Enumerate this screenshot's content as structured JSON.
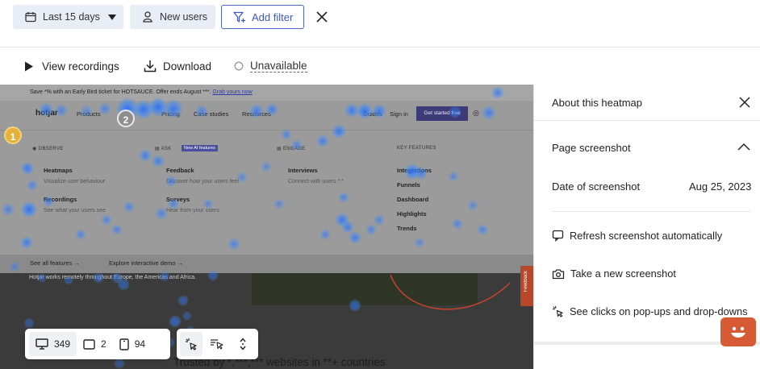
{
  "filters": {
    "date_range": "Last 15 days",
    "segment": "New users",
    "add_filter": "Add filter"
  },
  "actions": {
    "view_recordings": "View recordings",
    "download": "Download",
    "unavailable": "Unavailable"
  },
  "site": {
    "banner": "Save *% with an Early Bird ticket for HOTSAUCE. Offer ends August ***.",
    "banner_link": "Grab yours now",
    "logo": "hotjar",
    "nav": [
      "Products",
      "Pricing",
      "Case studies",
      "Resources",
      "Guides",
      "Sign in"
    ],
    "cta": "Get started free",
    "sections": {
      "observe": "OBSERVE",
      "ask": "ASK",
      "new_ai": "New AI features",
      "engage": "ENGAGE",
      "key_features": "KEY FEATURES"
    },
    "items": {
      "heatmaps": "Heatmaps",
      "heatmaps_desc": "Visualize user behaviour",
      "recordings": "Recordings",
      "recordings_desc": "See what your users see",
      "feedback": "Feedback",
      "feedback_desc": "Discover how your users feel",
      "surveys": "Surveys",
      "surveys_desc": "Hear from your users",
      "interviews": "Interviews",
      "interviews_desc": "Connect with users *:*",
      "key": [
        "Integrations",
        "Funnels",
        "Dashboard",
        "Highlights",
        "Trends"
      ]
    },
    "see_all": "See all features →",
    "explore": "Explore interactive demo →",
    "hotjar_text": "Hotjar works remotely throughout Europe, the Americas and Africa.",
    "trusted": "Trusted by *,***,*** websites in **+ countries",
    "feedback_tab": "Feedback"
  },
  "markers": [
    "1",
    "2"
  ],
  "toolbar": {
    "desktop_count": "349",
    "tablet_count": "2",
    "mobile_count": "94"
  },
  "panel": {
    "title": "About this heatmap",
    "section": "Page screenshot",
    "date_label": "Date of screenshot",
    "date_value": "Aug 25, 2023",
    "refresh": "Refresh screenshot automatically",
    "take_new": "Take a new screenshot",
    "see_clicks": "See clicks on pop-ups and drop-downs"
  },
  "colors": {
    "accent": "#4c66c9",
    "chip_bg": "#e8edf6",
    "heat_blue": "#2f7df6",
    "fab": "#d65a33"
  }
}
